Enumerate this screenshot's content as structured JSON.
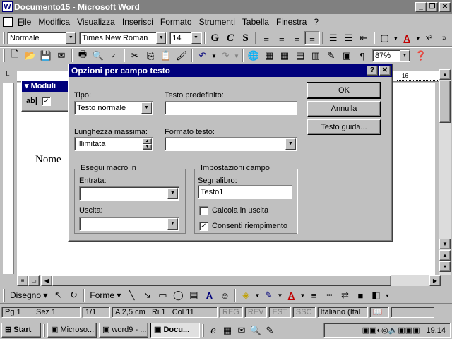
{
  "window": {
    "title": "Documento15 - Microsoft Word",
    "app_icon": "W"
  },
  "menu": [
    "File",
    "Modifica",
    "Visualizza",
    "Inserisci",
    "Formato",
    "Strumenti",
    "Tabella",
    "Finestra",
    "?"
  ],
  "format_toolbar": {
    "style": "Normale",
    "font": "Times New Roman",
    "size": "14",
    "bold": "G",
    "italic": "C",
    "underline": "S"
  },
  "standard_toolbar": {
    "zoom": "87%"
  },
  "ruler": {
    "mark": "16"
  },
  "document": {
    "text": "Nome"
  },
  "moduli_toolbar": {
    "title": "Moduli",
    "textfield_icon": "ab|"
  },
  "dialog": {
    "title": "Opzioni per campo testo",
    "tipo_label": "Tipo:",
    "tipo_value": "Testo normale",
    "testo_predefinito_label": "Testo predefinito:",
    "testo_predefinito_value": "",
    "lunghezza_label": "Lunghezza massima:",
    "lunghezza_value": "Illimitata",
    "formato_label": "Formato testo:",
    "formato_value": "",
    "macro_group": "Esegui macro in",
    "entrata_label": "Entrata:",
    "uscita_label": "Uscita:",
    "impostazioni_group": "Impostazioni campo",
    "segnalibro_label": "Segnalibro:",
    "segnalibro_value": "Testo1",
    "calcola_label": "Calcola in uscita",
    "consenti_label": "Consenti riempimento",
    "calcola_checked": false,
    "consenti_checked": true,
    "ok": "OK",
    "annulla": "Annulla",
    "guida": "Testo guida..."
  },
  "drawing_toolbar": {
    "disegno": "Disegno",
    "forme": "Forme"
  },
  "status": {
    "page": "Pg 1",
    "section": "Sez 1",
    "pages": "1/1",
    "pos": "A 2,5 cm",
    "line": "Ri 1",
    "col": "Col 11",
    "reg": "REG",
    "rev": "REV",
    "est": "EST",
    "ssc": "SSC",
    "lang": "Italiano (Ital"
  },
  "taskbar": {
    "start": "Start",
    "tasks": [
      "Microso...",
      "word9 - ...",
      "Docu..."
    ],
    "time": "19.14"
  }
}
